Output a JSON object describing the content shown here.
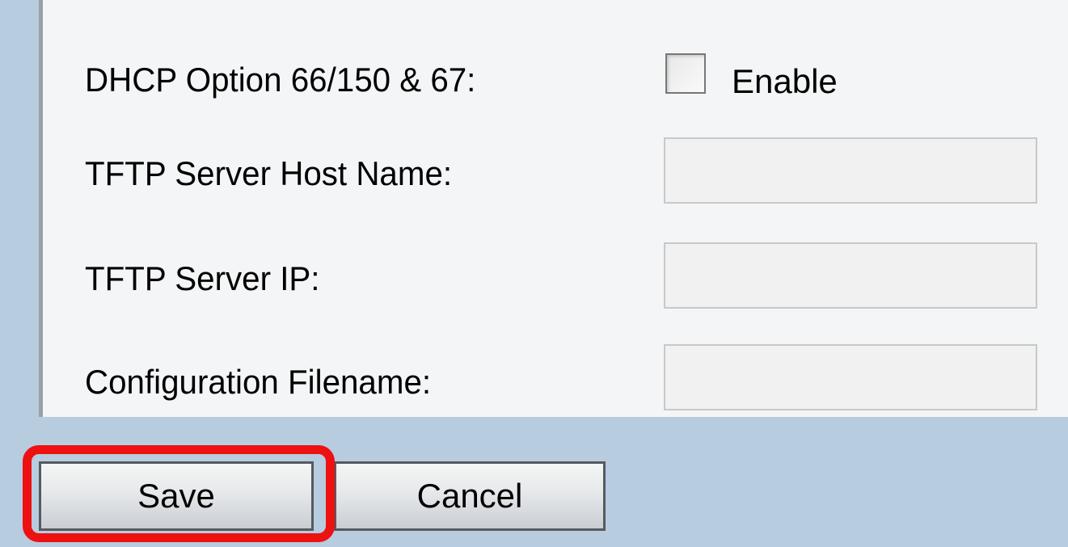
{
  "form": {
    "dhcp_option_label": "DHCP Option 66/150 & 67:",
    "enable_label": "Enable",
    "enable_checked": false,
    "tftp_host_name_label": "TFTP Server Host Name:",
    "tftp_host_name_value": "",
    "tftp_server_ip_label": "TFTP Server IP:",
    "tftp_server_ip_value": "",
    "config_filename_label": "Configuration Filename:",
    "config_filename_value": ""
  },
  "buttons": {
    "save_label": "Save",
    "cancel_label": "Cancel"
  },
  "highlight": {
    "target": "save-button",
    "color": "#ee1111"
  },
  "colors": {
    "background": "#b8cce0",
    "panel": "#f4f5f6"
  }
}
